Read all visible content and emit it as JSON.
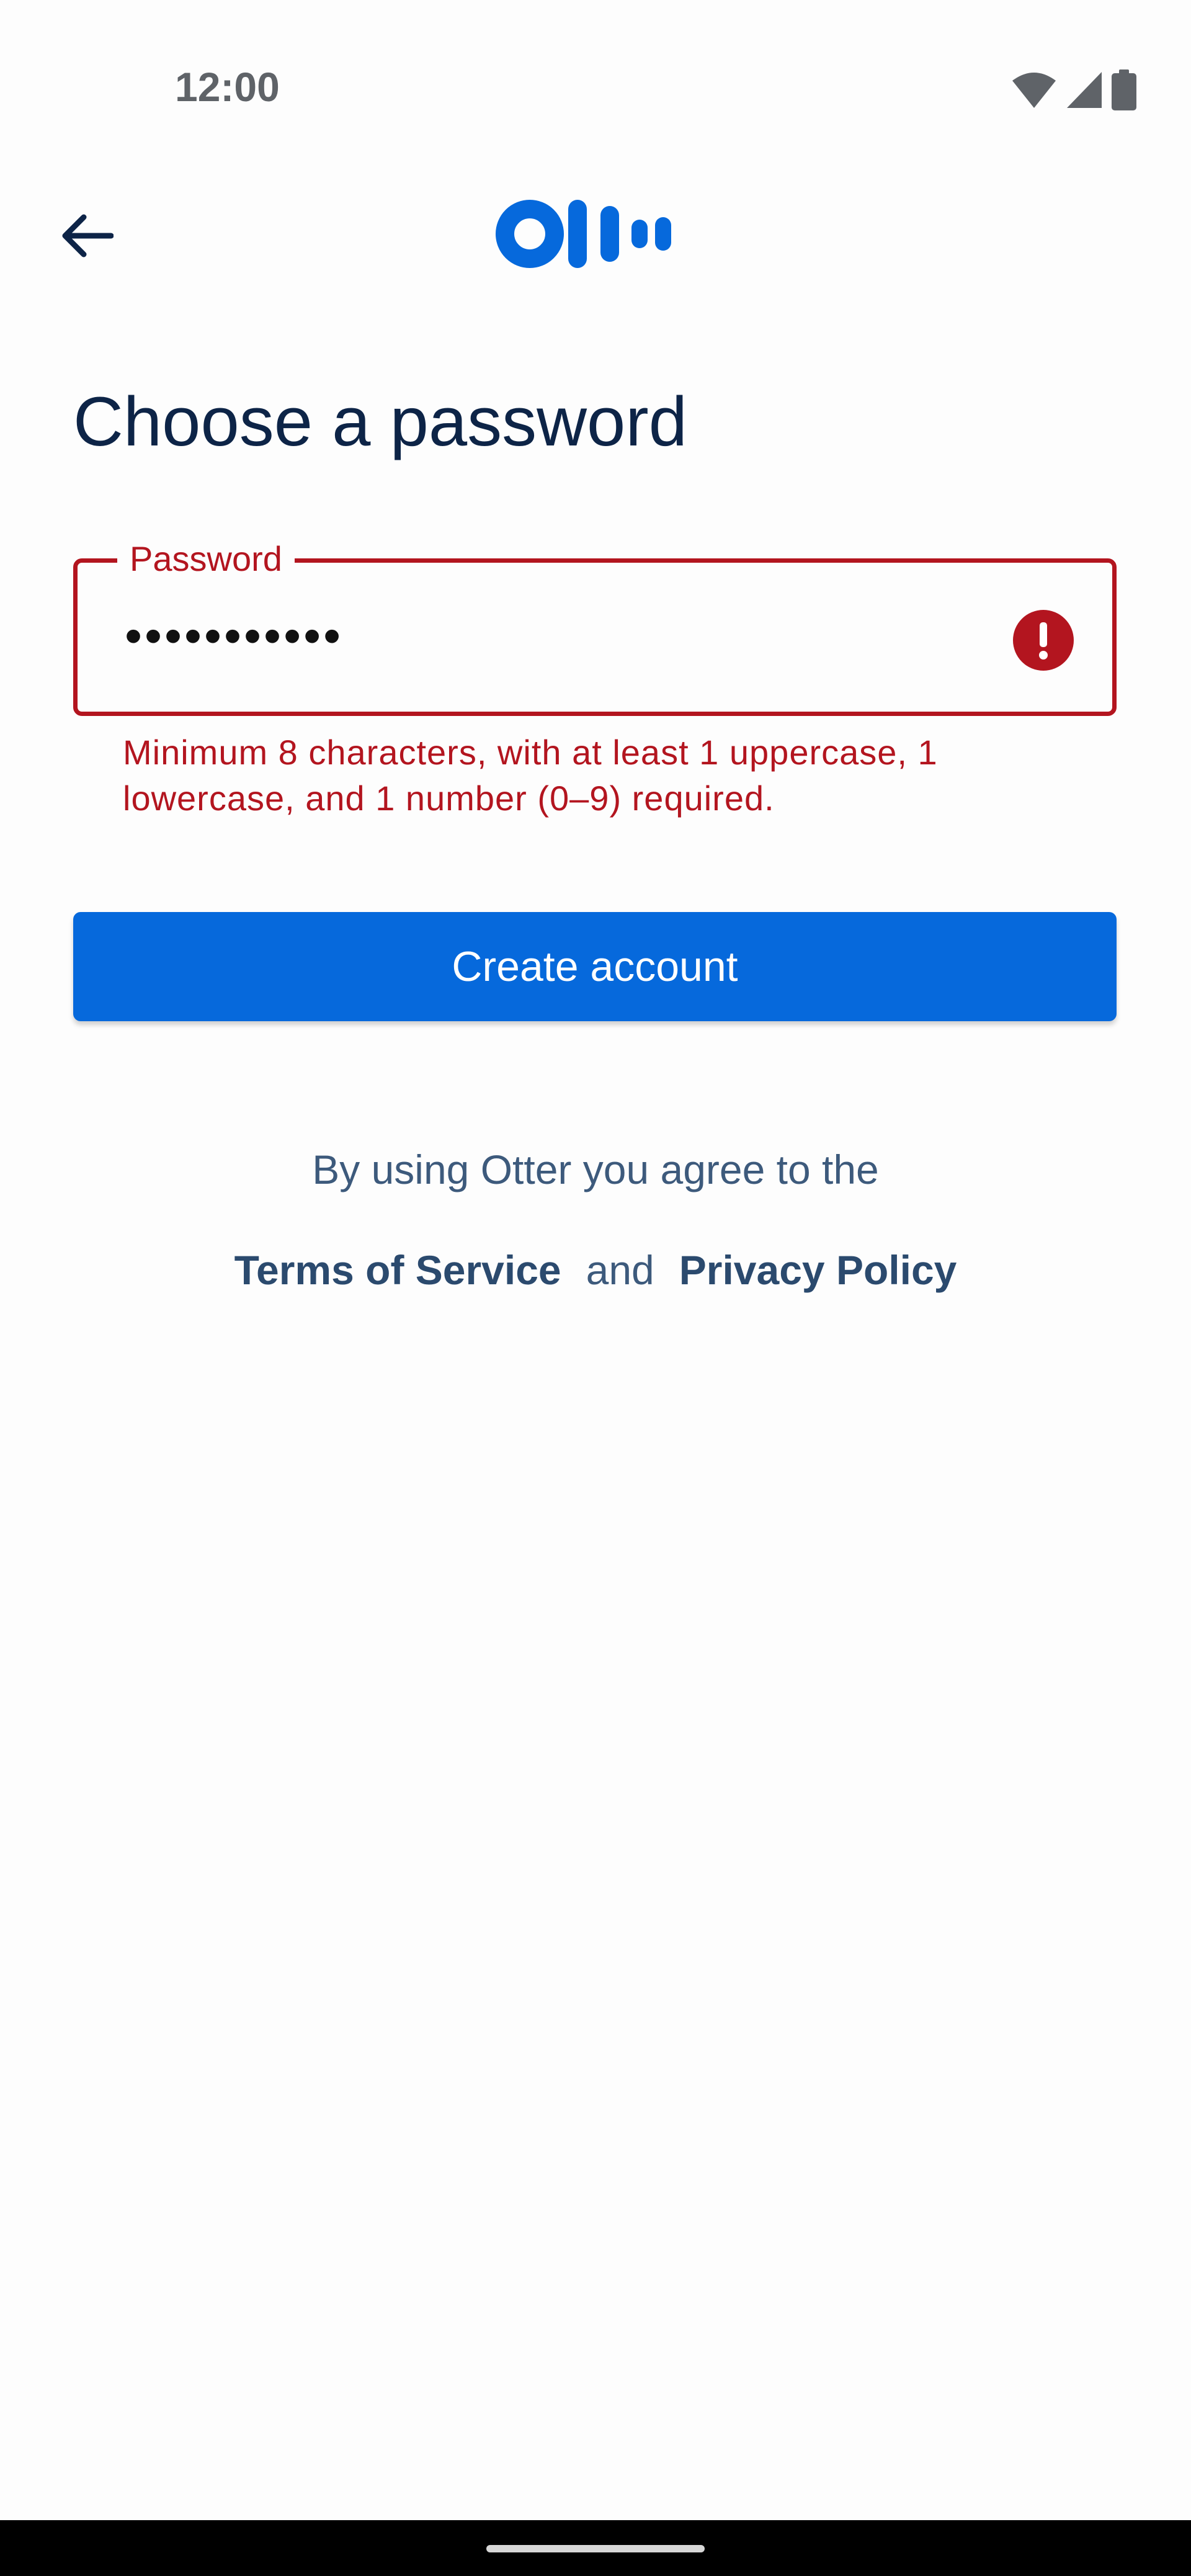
{
  "status_bar": {
    "time": "12:00",
    "icons": [
      "wifi-icon",
      "cellular-signal-icon",
      "battery-icon"
    ]
  },
  "header": {
    "back_icon": "arrow-left-icon",
    "logo": "otter-logo"
  },
  "title": "Choose a password",
  "password_field": {
    "label": "Password",
    "value": "•••••••••••",
    "error_icon": "error-exclamation-icon",
    "helper_text": "Minimum 8 characters, with at least 1 uppercase, 1 lowercase, and 1 number (0–9) required."
  },
  "create_button": {
    "label": "Create account"
  },
  "agreement": {
    "text": "By using Otter you agree to the",
    "terms_label": "Terms of Service",
    "and_label": "and",
    "privacy_label": "Privacy Policy"
  },
  "colors": {
    "primary": "#0669dc",
    "error": "#b3151f",
    "title": "#0d2447",
    "body_text": "#3d5a7c",
    "background": "#fdfdfd"
  }
}
